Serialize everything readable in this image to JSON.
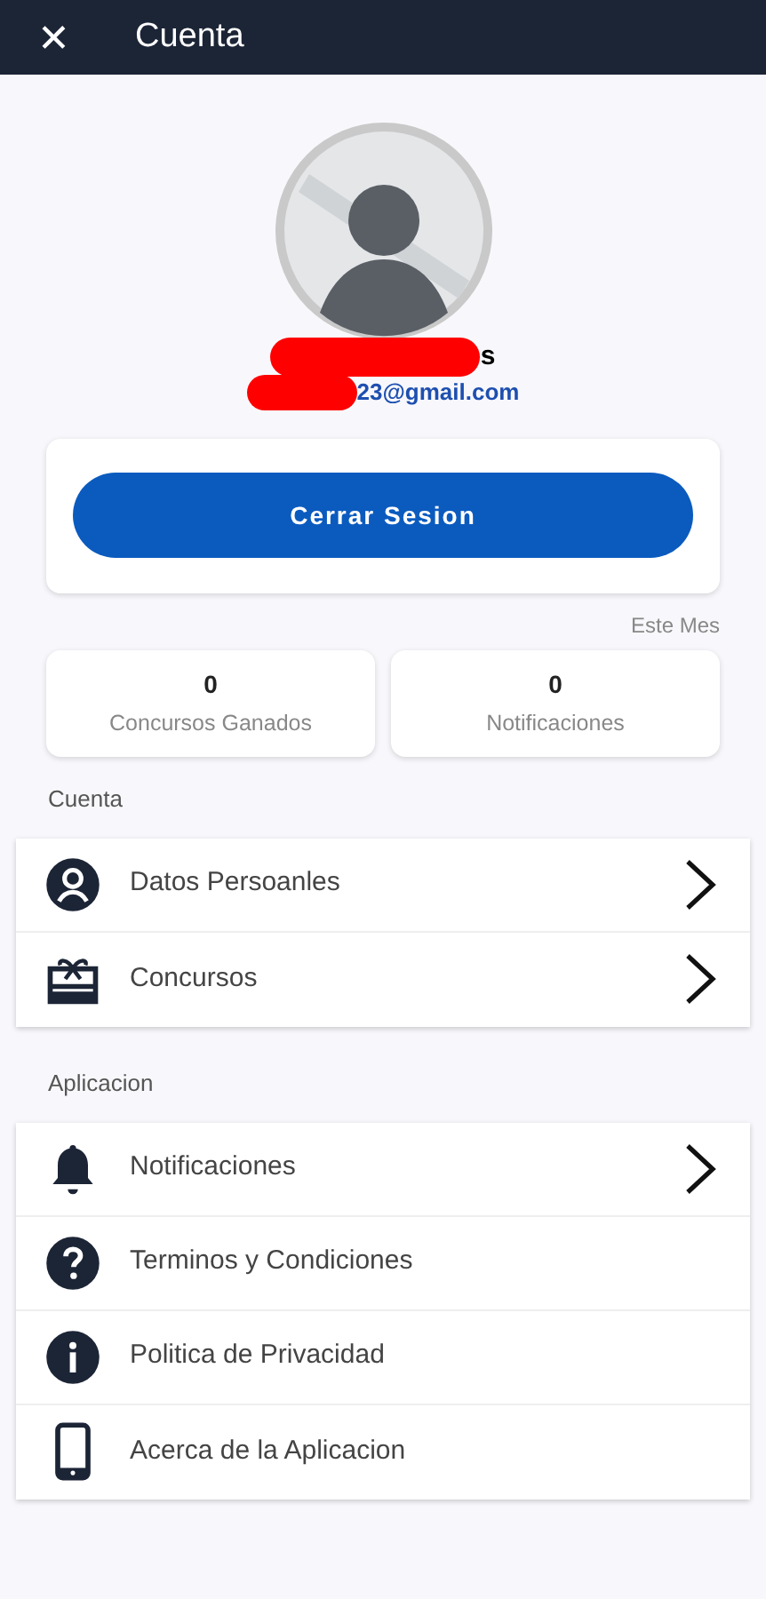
{
  "header": {
    "close": "✕",
    "title": "Cuenta"
  },
  "profile": {
    "name_fragment": "s",
    "email_fragment": "23@gmail.com"
  },
  "logout_button": "Cerrar Sesion",
  "period": "Este Mes",
  "stats": [
    {
      "value": "0",
      "label": "Concursos Ganados"
    },
    {
      "value": "0",
      "label": "Notificaciones"
    }
  ],
  "sections": [
    {
      "title": "Cuenta",
      "items": [
        {
          "kind": "person",
          "label": "Datos Persoanles",
          "arrow": true
        },
        {
          "kind": "gift",
          "label": "Concursos",
          "arrow": true
        }
      ]
    },
    {
      "title": "Aplicacion",
      "items": [
        {
          "kind": "bell",
          "label": "Notificaciones",
          "arrow": true
        },
        {
          "kind": "help",
          "label": "Terminos y Condiciones",
          "arrow": false
        },
        {
          "kind": "info",
          "label": "Politica de Privacidad",
          "arrow": false
        },
        {
          "kind": "phone",
          "label": "Acerca de la Aplicacion",
          "arrow": false
        }
      ]
    }
  ]
}
